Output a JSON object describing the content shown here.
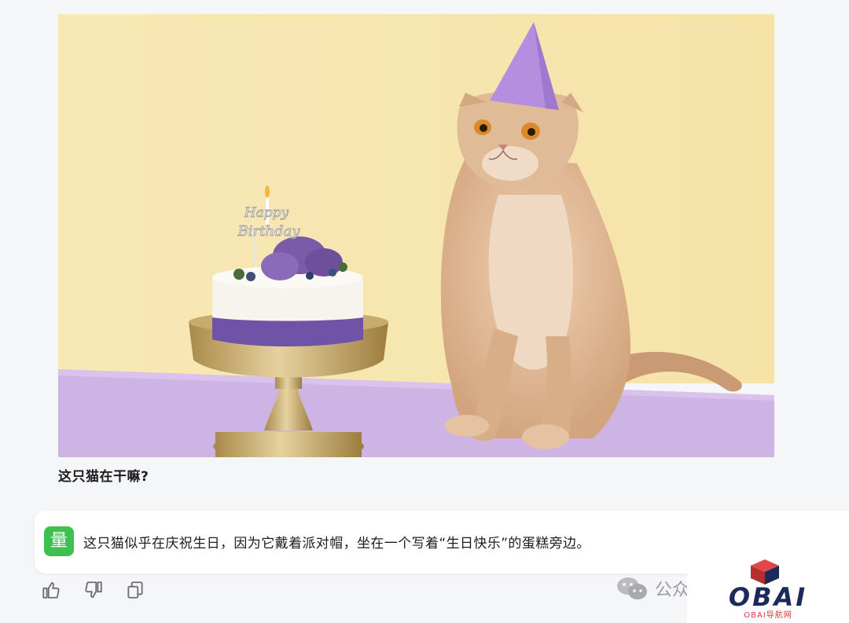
{
  "image": {
    "alt": "",
    "cake_topper_line1": "Happy",
    "cake_topper_line2": "Birthday"
  },
  "user_message": {
    "text": "这只猫在干嘛?"
  },
  "assistant_message": {
    "avatar_char": "量",
    "text": "这只猫似乎在庆祝生日，因为它戴着派对帽，坐在一个写着“生日快乐”的蛋糕旁边。"
  },
  "actions": [
    {
      "name": "like-button",
      "icon": "thumbs-up-icon"
    },
    {
      "name": "dislike-button",
      "icon": "thumbs-down-icon"
    },
    {
      "name": "copy-button",
      "icon": "copy-icon"
    }
  ],
  "watermark": {
    "text": "公众"
  },
  "logo": {
    "main": "OBAI",
    "sub": "OBAI导航网"
  },
  "colors": {
    "avatar_bg": "#3fbf4f",
    "wall": "#f7e6b0",
    "table": "#cfb5e6",
    "hat": "#b58ee0",
    "logo_red": "#d33b3b",
    "logo_navy": "#1b2a5a"
  }
}
